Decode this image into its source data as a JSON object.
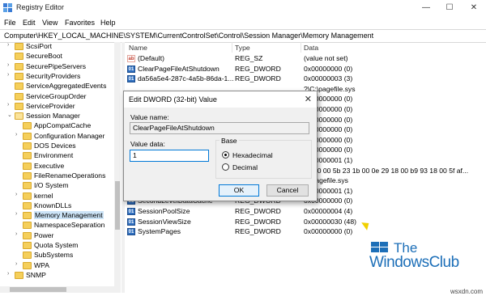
{
  "window": {
    "title": "Registry Editor",
    "minimize_glyph": "—",
    "maximize_glyph": "☐",
    "close_glyph": "✕"
  },
  "menu": [
    "File",
    "Edit",
    "View",
    "Favorites",
    "Help"
  ],
  "address": "Computer\\HKEY_LOCAL_MACHINE\\SYSTEM\\CurrentControlSet\\Control\\Session Manager\\Memory Management",
  "tree": [
    {
      "label": "ScsiPort",
      "chev": "›"
    },
    {
      "label": "SecureBoot",
      "chev": ""
    },
    {
      "label": "SecurePipeServers",
      "chev": "›"
    },
    {
      "label": "SecurityProviders",
      "chev": "›"
    },
    {
      "label": "ServiceAggregatedEvents",
      "chev": ""
    },
    {
      "label": "ServiceGroupOrder",
      "chev": ""
    },
    {
      "label": "ServiceProvider",
      "chev": "›"
    },
    {
      "label": "Session Manager",
      "chev": "⌄"
    },
    {
      "label": "AppCompatCache",
      "chev": ""
    },
    {
      "label": "Configuration Manager",
      "chev": "›"
    },
    {
      "label": "DOS Devices",
      "chev": ""
    },
    {
      "label": "Environment",
      "chev": ""
    },
    {
      "label": "Executive",
      "chev": ""
    },
    {
      "label": "FileRenameOperations",
      "chev": ""
    },
    {
      "label": "I/O System",
      "chev": ""
    },
    {
      "label": "kernel",
      "chev": "›"
    },
    {
      "label": "KnownDLLs",
      "chev": ""
    },
    {
      "label": "Memory Management",
      "chev": "›"
    },
    {
      "label": "NamespaceSeparation",
      "chev": ""
    },
    {
      "label": "Power",
      "chev": "›"
    },
    {
      "label": "Quota System",
      "chev": ""
    },
    {
      "label": "SubSystems",
      "chev": ""
    },
    {
      "label": "WPA",
      "chev": "›"
    },
    {
      "label": "SNMP",
      "chev": "›"
    }
  ],
  "columns": {
    "name": "Name",
    "type": "Type",
    "data": "Data"
  },
  "values": [
    {
      "name": "(Default)",
      "type": "REG_SZ",
      "data": "(value not set)",
      "kind": "sz"
    },
    {
      "name": "ClearPageFileAtShutdown",
      "type": "REG_DWORD",
      "data": "0x00000000 (0)",
      "kind": "dw"
    },
    {
      "name": "da56a5e4-287c-4a5b-86da-1...",
      "type": "REG_DWORD",
      "data": "0x00000003 (3)",
      "kind": "dw"
    },
    {
      "name": "",
      "type": "",
      "data": "?\\C:\\pagefile.sys",
      "kind": "hidden"
    },
    {
      "name": "",
      "type": "",
      "data": "0x00000000 (0)",
      "kind": "hidden"
    },
    {
      "name": "",
      "type": "",
      "data": "0x00000000 (0)",
      "kind": "hidden"
    },
    {
      "name": "",
      "type": "",
      "data": "0x00000000 (0)",
      "kind": "hidden"
    },
    {
      "name": "",
      "type": "",
      "data": "0x00000000 (0)",
      "kind": "hidden"
    },
    {
      "name": "",
      "type": "",
      "data": "0x00000000 (0)",
      "kind": "hidden"
    },
    {
      "name": "",
      "type": "",
      "data": "0x00000000 (0)",
      "kind": "hidden"
    },
    {
      "name": "",
      "type": "",
      "data": "0x00000001 (1)",
      "kind": "hidden"
    },
    {
      "name": "",
      "type": "",
      "data": "01 00 00 5b 23 1b 00 0e 29 18 00 b9 93 18 00 5f af...",
      "kind": "hidden"
    },
    {
      "name": "PagingFiles",
      "type": "REG_MULTI_SZ",
      "data": "?:\\pagefile.sys",
      "kind": "sz"
    },
    {
      "name": "PhysicalAddressExtension",
      "type": "REG_DWORD",
      "data": "0x00000001 (1)",
      "kind": "dw"
    },
    {
      "name": "SecondLevelDataCache",
      "type": "REG_DWORD",
      "data": "0x00000000 (0)",
      "kind": "dw"
    },
    {
      "name": "SessionPoolSize",
      "type": "REG_DWORD",
      "data": "0x00000004 (4)",
      "kind": "dw"
    },
    {
      "name": "SessionViewSize",
      "type": "REG_DWORD",
      "data": "0x00000030 (48)",
      "kind": "dw"
    },
    {
      "name": "SystemPages",
      "type": "REG_DWORD",
      "data": "0x00000000 (0)",
      "kind": "dw"
    }
  ],
  "dialog": {
    "title": "Edit DWORD (32-bit) Value",
    "close_glyph": "✕",
    "value_name_label": "Value name:",
    "value_name": "ClearPageFileAtShutdown",
    "value_data_label": "Value data:",
    "value_data": "1",
    "base_label": "Base",
    "hex_label": "Hexadecimal",
    "dec_label": "Decimal",
    "ok_label": "OK",
    "cancel_label": "Cancel"
  },
  "watermark": {
    "line1": "The",
    "line2": "WindowsClub"
  },
  "corner_mark": "wsxdn.com",
  "colors": {
    "selection": "#cce4f7",
    "accent": "#0078d7",
    "watermark": "#1d6fb8"
  }
}
